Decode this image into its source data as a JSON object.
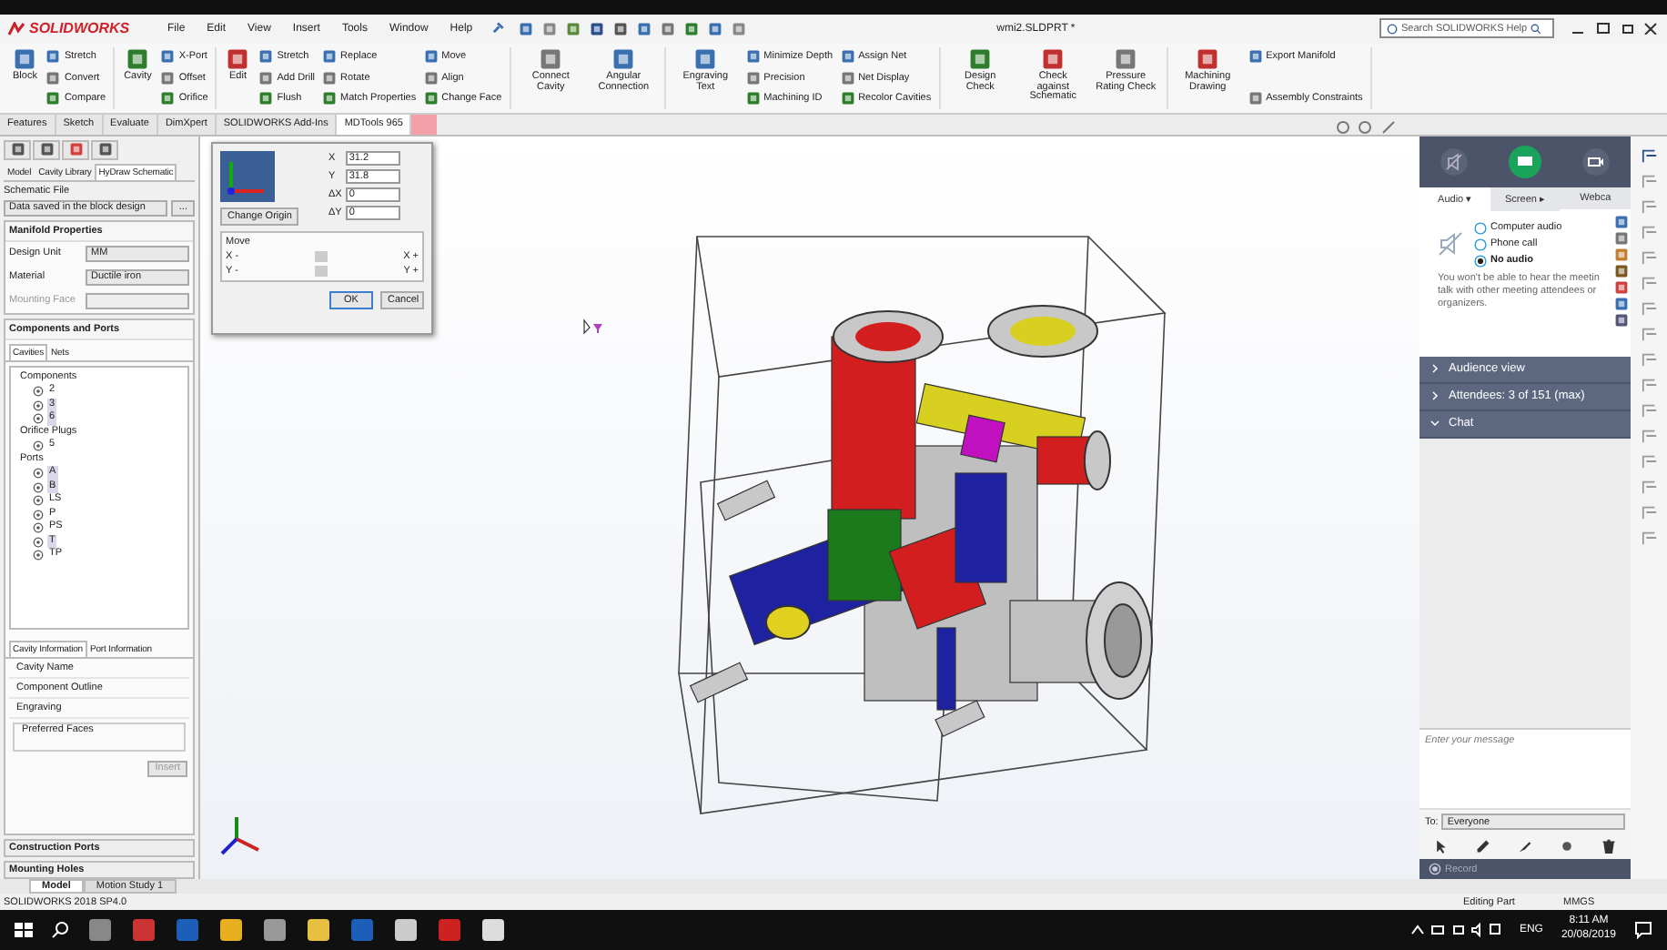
{
  "app": {
    "logo": "SOLIDWORKS",
    "menu": [
      "File",
      "Edit",
      "View",
      "Insert",
      "Tools",
      "Window",
      "Help"
    ],
    "document_title": "wmi2.SLDPRT *",
    "search_placeholder": "Search SOLIDWORKS Help"
  },
  "ribbon": [
    {
      "columns": [
        [
          {
            "label": "Block"
          }
        ],
        [
          {
            "label": "Stretch"
          },
          {
            "label": "Convert"
          },
          {
            "label": "Compare"
          }
        ]
      ]
    },
    {
      "columns": [
        [
          {
            "label": "Cavity"
          }
        ],
        [
          {
            "label": "X-Port"
          },
          {
            "label": "Offset"
          },
          {
            "label": "Orifice"
          }
        ]
      ]
    },
    {
      "columns": [
        [
          {
            "label": "Edit"
          }
        ],
        [
          {
            "label": "Stretch"
          },
          {
            "label": "Add Drill"
          },
          {
            "label": "Flush"
          }
        ],
        [
          {
            "label": "Replace"
          },
          {
            "label": "Rotate"
          },
          {
            "label": "Match Properties"
          }
        ],
        [
          {
            "label": "Move"
          },
          {
            "label": "Align"
          },
          {
            "label": "Change Face"
          }
        ]
      ]
    },
    {
      "columns": [
        [
          {
            "label": "Connect Cavity"
          }
        ],
        [
          {
            "label": "Angular Connection"
          }
        ]
      ]
    },
    {
      "columns": [
        [
          {
            "label": "Engraving Text"
          }
        ],
        [
          {
            "label": "Minimize Depth"
          },
          {
            "label": "Precision"
          },
          {
            "label": "Machining ID"
          }
        ],
        [
          {
            "label": "Assign Net"
          },
          {
            "label": "Net Display"
          },
          {
            "label": "Recolor Cavities"
          }
        ]
      ]
    },
    {
      "columns": [
        [
          {
            "label": "Design Check"
          }
        ],
        [
          {
            "label": "Check against Schematic"
          }
        ],
        [
          {
            "label": "Pressure Rating Check"
          }
        ]
      ]
    },
    {
      "columns": [
        [
          {
            "label": "Machining Drawing"
          }
        ],
        [
          {
            "label": "Export Manifold"
          },
          {
            "label": "Assembly Constraints"
          }
        ]
      ]
    }
  ],
  "command_tabs": [
    {
      "label": "Features",
      "selected": false
    },
    {
      "label": "Sketch",
      "selected": false
    },
    {
      "label": "Evaluate",
      "selected": false
    },
    {
      "label": "DimXpert",
      "selected": false
    },
    {
      "label": "SOLIDWORKS Add-Ins",
      "selected": false
    },
    {
      "label": "MDTools 965",
      "selected": true
    }
  ],
  "left_panel": {
    "tabs": [
      {
        "label": "Model",
        "selected": false
      },
      {
        "label": "Cavity Library",
        "selected": false
      },
      {
        "label": "HyDraw Schematic",
        "selected": true
      }
    ],
    "schematic_file": {
      "label": "Schematic File",
      "value": "Data saved in the block design",
      "button": "..."
    },
    "manifold_properties": {
      "title": "Manifold Properties",
      "fields": [
        {
          "label": "Design Unit",
          "value": "MM",
          "disabled": false
        },
        {
          "label": "Material",
          "value": "Ductile iron",
          "disabled": false
        },
        {
          "label": "Mounting Face",
          "disabled": true
        }
      ]
    },
    "components": {
      "title": "Components and Ports",
      "tabs": [
        {
          "label": "Cavities",
          "selected": true
        },
        {
          "label": "Nets",
          "selected": false
        }
      ],
      "tree": [
        {
          "label": "Components",
          "children": [
            {
              "label": "2",
              "selected": false
            },
            {
              "label": "3",
              "selected": true
            },
            {
              "label": "6",
              "selected": true
            }
          ]
        },
        {
          "label": "Orifice Plugs",
          "children": [
            {
              "label": "5",
              "selected": false
            }
          ]
        },
        {
          "label": "Ports",
          "children": [
            {
              "label": "A",
              "selected": true
            },
            {
              "label": "B",
              "selected": true
            },
            {
              "label": "LS",
              "selected": false
            },
            {
              "label": "P",
              "selected": false
            },
            {
              "label": "PS",
              "selected": false
            },
            {
              "label": "T",
              "selected": true
            },
            {
              "label": "TP",
              "selected": false
            }
          ]
        }
      ]
    },
    "info_tabs": [
      {
        "label": "Cavity Information",
        "selected": true
      },
      {
        "label": "Port Information",
        "selected": false
      }
    ],
    "info_rows": [
      "Cavity Name",
      "Component Outline",
      "Engraving"
    ],
    "preferred_faces": "Preferred Faces",
    "insert_button": {
      "label": "Insert",
      "disabled": true
    },
    "sections": [
      "Construction Ports",
      "Mounting Holes"
    ]
  },
  "origin_dialog": {
    "fields": [
      {
        "label": "X",
        "value": "31.2"
      },
      {
        "label": "Y",
        "value": "31.8"
      },
      {
        "label": "ΔX",
        "value": "0"
      },
      {
        "label": "ΔY",
        "value": "0"
      }
    ],
    "change_origin": "Change Origin",
    "move_title": "Move",
    "sliders": [
      {
        "min_label": "X -",
        "max_label": "X +",
        "level": 0.5
      },
      {
        "min_label": "Y -",
        "max_label": "Y +",
        "level": 0.5
      }
    ],
    "buttons": [
      "OK",
      "Cancel"
    ]
  },
  "meeting_panel": {
    "tabs": [
      {
        "label": "Audio ▾",
        "selected": true
      },
      {
        "label": "Screen ▸",
        "selected": false
      },
      {
        "label": "Webca",
        "selected": false
      }
    ],
    "audio_options": [
      {
        "label": "Computer audio",
        "selected": false
      },
      {
        "label": "Phone call",
        "selected": false
      },
      {
        "label": "No audio",
        "selected": true
      }
    ],
    "notice_lines": [
      "You won't be able to hear the meetin",
      "talk with other meeting attendees or",
      "organizers."
    ],
    "sections": [
      {
        "label": "Audience view",
        "expanded": false
      },
      {
        "label": "Attendees:  3 of 151 (max)",
        "expanded": false
      },
      {
        "label": "Chat",
        "expanded": true
      }
    ],
    "message_placeholder": "Enter your message",
    "to_label": "To:",
    "to_value": "Everyone",
    "record": "Record"
  },
  "bottom_tabs": [
    {
      "label": "Model",
      "selected": true
    },
    {
      "label": "Motion Study 1",
      "selected": false
    }
  ],
  "status_bar": {
    "version": "SOLIDWORKS 2018 SP4.0",
    "mode": "Editing Part",
    "units": "MMGS"
  },
  "taskbar": {
    "language": "ENG",
    "time": "8:11 AM",
    "date": "20/08/2019"
  }
}
